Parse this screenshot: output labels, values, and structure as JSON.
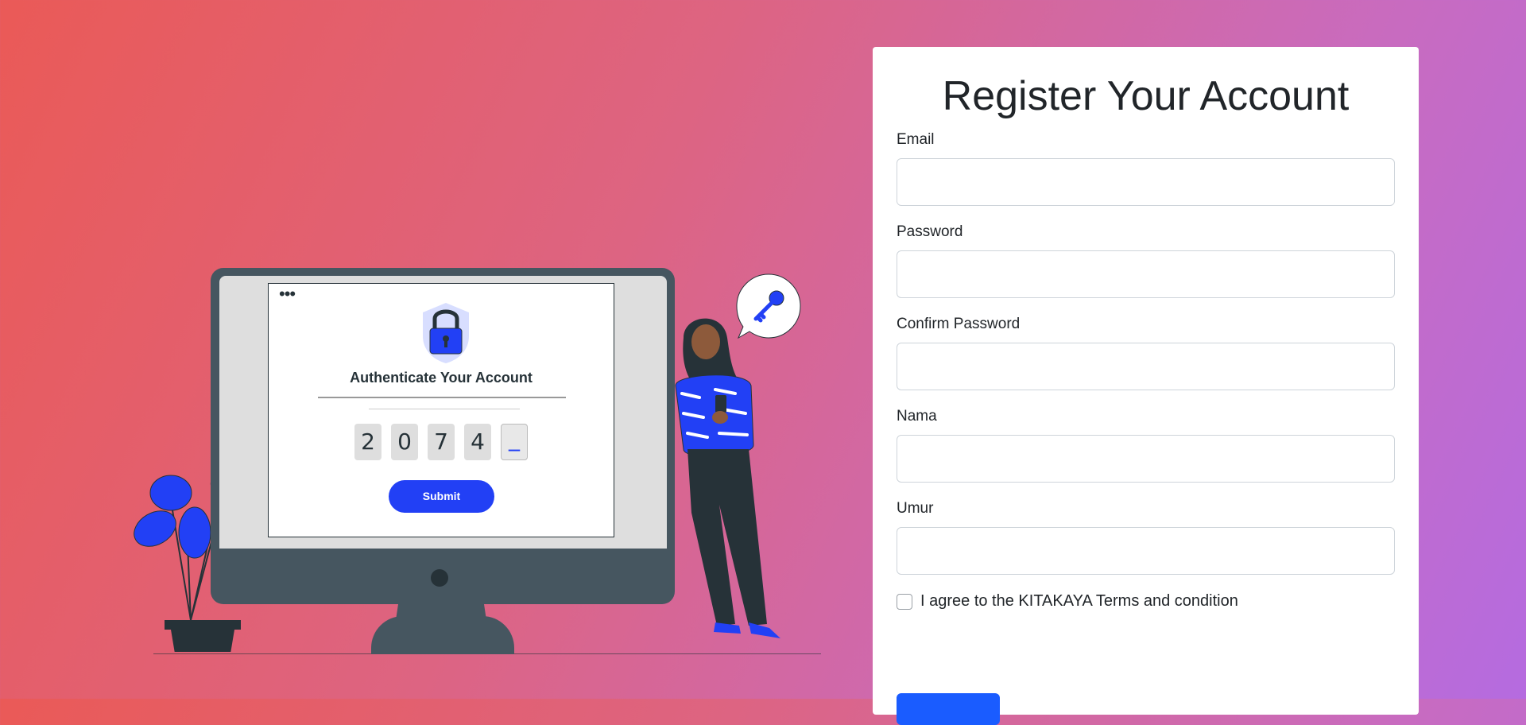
{
  "illustration": {
    "auth_title": "Authenticate Your Account",
    "otp_digits": [
      "2",
      "0",
      "7",
      "4"
    ],
    "otp_placeholder": "_",
    "submit_label": "Submit"
  },
  "form": {
    "title": "Register Your Account",
    "fields": {
      "email": {
        "label": "Email",
        "value": ""
      },
      "password": {
        "label": "Password",
        "value": ""
      },
      "confirm_password": {
        "label": "Confirm Password",
        "value": ""
      },
      "nama": {
        "label": "Nama",
        "value": ""
      },
      "umur": {
        "label": "Umur",
        "value": ""
      }
    },
    "terms_label": "I agree to the KITAKAYA Terms and condition",
    "terms_checked": false
  },
  "colors": {
    "accent": "#2240f5",
    "button": "#1a5cff"
  }
}
